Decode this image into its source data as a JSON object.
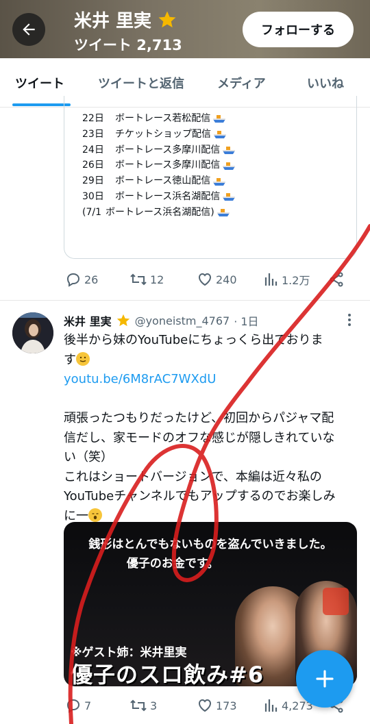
{
  "header": {
    "name": "米井 里実",
    "subtitle": "ツイート 2,713",
    "follow_label": "フォローする"
  },
  "tabs": [
    {
      "label": "ツイート",
      "active": true
    },
    {
      "label": "ツイートと返信",
      "active": false
    },
    {
      "label": "メディア",
      "active": false
    },
    {
      "label": "いいね",
      "active": false
    }
  ],
  "tweet1": {
    "schedule": [
      {
        "day": "22日",
        "text": "ボートレース若松配信"
      },
      {
        "day": "23日",
        "text": "チケットショップ配信"
      },
      {
        "day": "24日",
        "text": "ボートレース多摩川配信"
      },
      {
        "day": "26日",
        "text": "ボートレース多摩川配信"
      },
      {
        "day": "29日",
        "text": "ボートレース徳山配信"
      },
      {
        "day": "30日",
        "text": "ボートレース浜名湖配信"
      },
      {
        "day": "(7/1",
        "text": "ボートレース浜名湖配信)"
      }
    ],
    "replies": "26",
    "retweets": "12",
    "likes": "240",
    "views": "1.2万"
  },
  "tweet2": {
    "name": "米井 里実",
    "handle": "@yoneistm_4767",
    "time": "· 1日",
    "line1": "後半から妹のYouTubeにちょっくら出ておりま",
    "line2": "す",
    "link": "youtu.be/6M8rAC7WXdU",
    "line3": "頑張ったつもりだったけど、初回からパジャマ配",
    "line4": "信だし、家モードのオフな感じが隠しきれていな",
    "line5": "い（笑）",
    "line6": "これはショートバージョンで、本編は近々私の",
    "line7": "YouTubeチャンネルでもアップするのでお楽しみ",
    "line8": "に一",
    "media_line1": "銭形はとんでもないものを盗んでいきました。",
    "media_line2": "優子のお金です。",
    "media_guest": "※ゲスト姉：米井里実",
    "media_title": "優子のスロ飲み#6",
    "replies": "7",
    "retweets": "3",
    "likes": "173",
    "views": "4,273"
  },
  "colors": {
    "accent": "#1d9bf0",
    "text": "#0f1419",
    "muted": "#536471",
    "scribble": "#d81e1e"
  },
  "icons": [
    "back-arrow-icon",
    "verified-star-icon",
    "boat-icon",
    "reply-icon",
    "retweet-icon",
    "like-icon",
    "views-icon",
    "share-icon",
    "more-icon",
    "compose-plus-icon"
  ]
}
